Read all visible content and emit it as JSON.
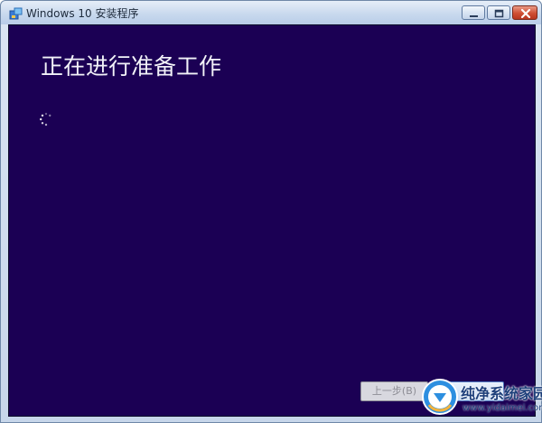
{
  "window": {
    "title": "Windows 10 安装程序",
    "icons": {
      "app": "setup-icon",
      "minimize": "minimize-icon",
      "maximize": "maximize-icon",
      "close": "close-icon"
    }
  },
  "main": {
    "heading": "正在进行准备工作",
    "spinner_icon": "loading-spinner-icon"
  },
  "footer": {
    "back_label": "上一步(B)"
  },
  "watermark": {
    "name": "纯净系统家园",
    "url": "www.yidaimei.com",
    "logo_icon": "site-logo-icon"
  },
  "colors": {
    "client_background": "#1b0054",
    "heading_text": "#f2f2f8",
    "titlebar": "#c9d9ee",
    "close_button": "#cf4f34"
  }
}
